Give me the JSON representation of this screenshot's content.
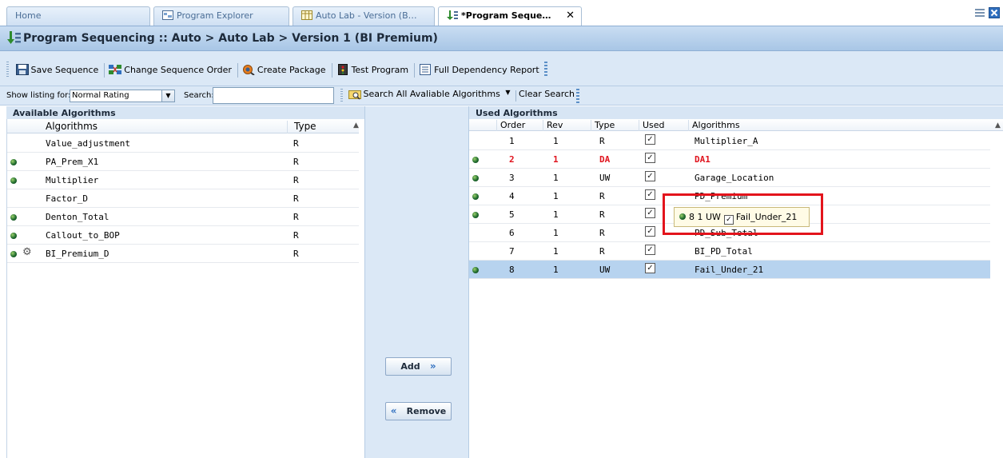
{
  "tabs": [
    {
      "label": "Home",
      "icon": "home-icon"
    },
    {
      "label": "Program Explorer",
      "icon": "explorer-icon"
    },
    {
      "label": "Auto Lab - Version (B…",
      "icon": "table-icon"
    },
    {
      "label": "*Program Seque…",
      "icon": "sequence-icon",
      "close": "✕"
    }
  ],
  "title": "Program Sequencing :: Auto > Auto Lab > Version 1 (BI Premium)",
  "toolbar": {
    "save_sequence": "Save Sequence",
    "change_order": "Change Sequence Order",
    "create_package": "Create Package",
    "test_program": "Test Program",
    "dependency_report": "Full Dependency Report"
  },
  "search": {
    "show_listing_label": "Show listing for:",
    "listing_value": "Normal Rating",
    "search_label": "Search:",
    "search_value": "",
    "search_all": "Search All Avaliable Algorithms",
    "clear_search": "Clear Search"
  },
  "available": {
    "title": "Available Algorithms",
    "col_algorithms": "Algorithms",
    "col_type": "Type",
    "rows": [
      {
        "name": "Value_adjustment",
        "type": "R",
        "dot": false,
        "gear": false
      },
      {
        "name": "PA_Prem_X1",
        "type": "R",
        "dot": true,
        "gear": false
      },
      {
        "name": "Multiplier",
        "type": "R",
        "dot": true,
        "gear": false
      },
      {
        "name": "Factor_D",
        "type": "R",
        "dot": false,
        "gear": false
      },
      {
        "name": "Denton_Total",
        "type": "R",
        "dot": true,
        "gear": false
      },
      {
        "name": "Callout_to_BOP",
        "type": "R",
        "dot": true,
        "gear": false
      },
      {
        "name": "BI_Premium_D",
        "type": "R",
        "dot": true,
        "gear": true
      }
    ]
  },
  "used": {
    "title": "Used Algorithms",
    "col_order": "Order",
    "col_rev": "Rev",
    "col_type": "Type",
    "col_used": "Used",
    "col_algorithms": "Algorithms",
    "check_glyph": "✓",
    "rows": [
      {
        "order": "1",
        "rev": "1",
        "type": "R",
        "alg": "Multiplier_A",
        "dot": false,
        "red": false,
        "selected": false
      },
      {
        "order": "2",
        "rev": "1",
        "type": "DA",
        "alg": "DA1",
        "dot": true,
        "red": true,
        "selected": false
      },
      {
        "order": "3",
        "rev": "1",
        "type": "UW",
        "alg": "Garage_Location",
        "dot": true,
        "red": false,
        "selected": false
      },
      {
        "order": "4",
        "rev": "1",
        "type": "R",
        "alg": "PD_Premium",
        "dot": true,
        "red": false,
        "selected": false
      },
      {
        "order": "5",
        "rev": "1",
        "type": "R",
        "alg": "",
        "dot": true,
        "red": false,
        "selected": false
      },
      {
        "order": "6",
        "rev": "1",
        "type": "R",
        "alg": "PD_Sub_Total",
        "dot": false,
        "red": false,
        "selected": false
      },
      {
        "order": "7",
        "rev": "1",
        "type": "R",
        "alg": "BI_PD_Total",
        "dot": false,
        "red": false,
        "selected": false
      },
      {
        "order": "8",
        "rev": "1",
        "type": "UW",
        "alg": "Fail_Under_21",
        "dot": true,
        "red": false,
        "selected": true
      }
    ]
  },
  "buttons": {
    "add": "Add",
    "remove": "Remove"
  },
  "drag_tip": {
    "text": "8 1 UW",
    "alg": "Fail_Under_21"
  },
  "colors": {
    "accent": "#a8c6e6",
    "selection": "#b7d3ef",
    "highlight": "#e3141c",
    "error_text": "#e0141e"
  }
}
